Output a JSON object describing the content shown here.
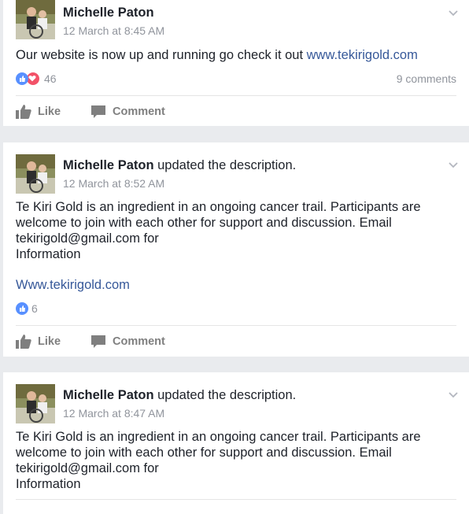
{
  "posts": [
    {
      "author": "Michelle Paton",
      "action": "",
      "timestamp": "12 March at 8:45 AM",
      "text": "Our website is now up and running go check it out ",
      "link": "www.tekirigold.com",
      "reaction_count": "46",
      "comments": "9 comments",
      "like_label": "Like",
      "comment_label": "Comment"
    },
    {
      "author": "Michelle Paton",
      "action": " updated the description.",
      "timestamp": "12 March at 8:52 AM",
      "text_lines": [
        "Te Kiri Gold is an ingredient in an ongoing cancer trail. Participants are",
        "welcome to join with each other for support and discussion. Email",
        "tekirigold@gmail.com for",
        "Information"
      ],
      "link": "Www.tekirigold.com",
      "reaction_count": "6",
      "like_label": "Like",
      "comment_label": "Comment"
    },
    {
      "author": "Michelle Paton",
      "action": " updated the description.",
      "timestamp": "12 March at 8:47 AM",
      "text_lines": [
        "Te Kiri Gold is an ingredient in an ongoing cancer trail. Participants are",
        "welcome to join with each other for support and discussion. Email",
        "tekirigold@gmail.com for",
        "Information"
      ]
    }
  ],
  "colors": {
    "background": "#e9ebee",
    "link": "#365899",
    "like_blue": "#5890ff",
    "love_red": "#f25268",
    "meta_gray": "#90949c"
  },
  "icons": {
    "chevron": "chevron-down-icon",
    "like": "thumbs-up-icon",
    "comment": "comment-bubble-icon",
    "reaction_like": "like-reaction-icon",
    "reaction_love": "love-reaction-icon"
  }
}
